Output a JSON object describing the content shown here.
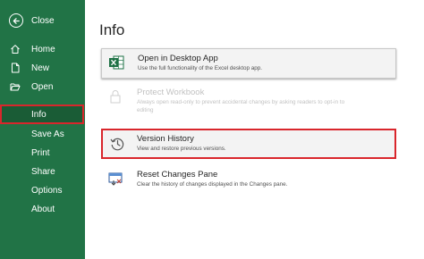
{
  "sidebar": {
    "close_label": "Close",
    "items": [
      {
        "label": "Home",
        "icon": "home-icon"
      },
      {
        "label": "New",
        "icon": "new-file-icon"
      },
      {
        "label": "Open",
        "icon": "folder-open-icon"
      },
      {
        "label": "Info"
      },
      {
        "label": "Save As"
      },
      {
        "label": "Print"
      },
      {
        "label": "Share"
      },
      {
        "label": "Options"
      },
      {
        "label": "About"
      }
    ],
    "selected": "Info"
  },
  "main": {
    "title": "Info",
    "options": [
      {
        "title": "Open in Desktop App",
        "description": "Use the full functionality of the Excel desktop app.",
        "icon": "excel-icon"
      },
      {
        "title": "Protect Workbook",
        "description": "Always open read-only to prevent accidental changes by asking readers to opt-in to",
        "description2": "editing",
        "icon": "lock-icon",
        "disabled": true
      },
      {
        "title": "Version History",
        "description": "View and restore previous versions.",
        "icon": "history-icon"
      },
      {
        "title": "Reset Changes Pane",
        "description": "Clear the history of changes displayed in the Changes pane.",
        "icon": "reset-pane-icon"
      }
    ]
  },
  "colors": {
    "sidebar": "#217346",
    "highlight": "#d9262c",
    "excel": "#1e7145"
  }
}
